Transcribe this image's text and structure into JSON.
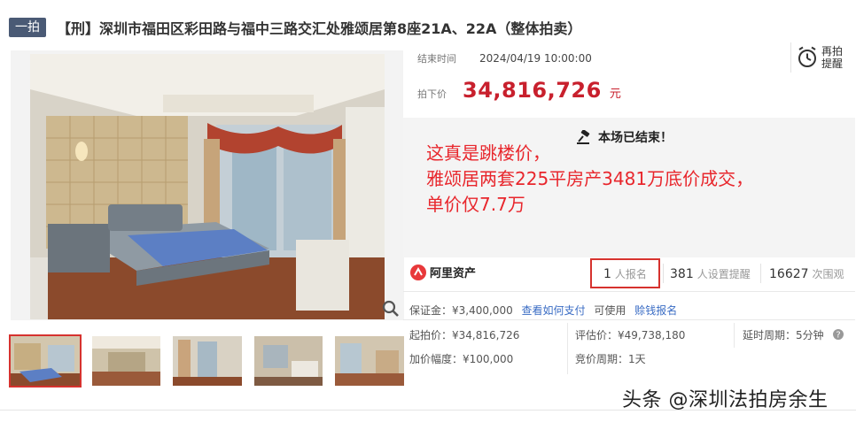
{
  "header": {
    "badge": "一拍",
    "title": "【刑】深圳市福田区彩田路与福中三路交汇处雅颂居第8座21A、22A（整体拍卖）"
  },
  "auction": {
    "end_time_label": "结束时间",
    "end_time_value": "2024/04/19 10:00:00",
    "price_label": "拍下价",
    "price_value": "34,816,726",
    "price_unit": "元",
    "remind_label_1": "再拍",
    "remind_label_2": "提醒"
  },
  "status": {
    "ended_text": "本场已结束！",
    "annotation_line1": "这真是跳楼价，",
    "annotation_line2": "雅颂居两套225平房产3481万底价成交，",
    "annotation_line3": "单价仅7.7万"
  },
  "stats": {
    "brand": "阿里资产",
    "signups_num": "1",
    "signups_label": "人报名",
    "reminders_num": "381",
    "reminders_label": "人设置提醒",
    "views_num": "16627",
    "views_label": "次围观"
  },
  "details": {
    "deposit": "保证金：¥3,400,000",
    "how_to_pay": "查看如何支付",
    "can_use": "可使用",
    "trustee_signup": "赊钱报名",
    "start_price": "起拍价：¥34,816,726",
    "appraisal": "评估价：¥49,738,180",
    "delay_period": "延时周期：5分钟",
    "increment": "加价幅度：¥100,000",
    "bid_period": "竞价周期：1天"
  },
  "watermark": "头条 @深圳法拍房余生",
  "colors": {
    "price_red": "#c8202d",
    "annotation_red": "#e8262c",
    "link_blue": "#3a6cc4",
    "badge_bg": "#4a5a75"
  }
}
